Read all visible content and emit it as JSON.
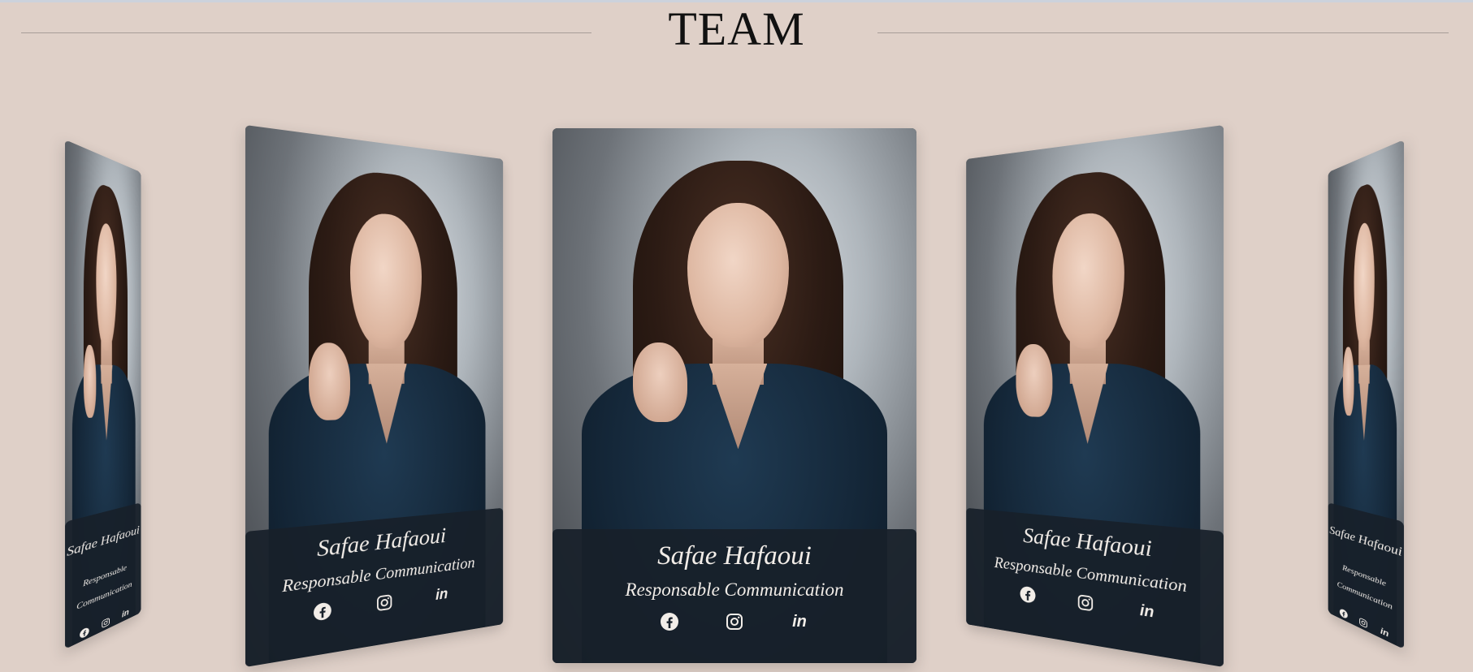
{
  "section": {
    "title": "TEAM"
  },
  "cards": [
    {
      "name": "Safae Hafaoui",
      "role": "Responsable Communication",
      "linkedin": "in"
    },
    {
      "name": "Safae Hafaoui",
      "role": "Responsable Communication",
      "linkedin": "in"
    },
    {
      "name": "Safae Hafaoui",
      "role": "Responsable Communication",
      "linkedin": "in"
    },
    {
      "name": "Safae Hafaoui",
      "role": "Responsable Communication",
      "linkedin": "in"
    },
    {
      "name": "Safae Hafaoui",
      "role": "Responsable Communication",
      "linkedin": "in"
    }
  ],
  "icons": [
    "facebook-icon",
    "instagram-icon",
    "linkedin-icon"
  ],
  "colors": {
    "background": "#dfd0c8",
    "info_panel": "#18202a",
    "text_light": "#f2ede8"
  }
}
